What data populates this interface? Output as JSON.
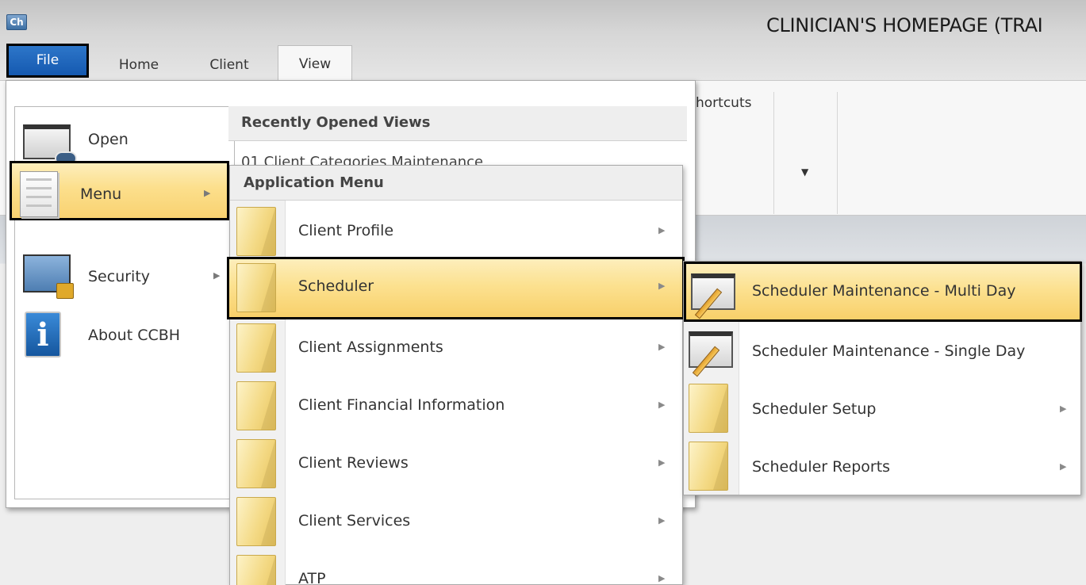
{
  "window": {
    "app_icon": "Ch",
    "title": "CLINICIAN'S HOMEPAGE (TRAI"
  },
  "tabs": {
    "file": "File",
    "home": "Home",
    "client": "Client",
    "view": "View"
  },
  "ribbon": {
    "group_label": "hortcuts",
    "dropdown_glyph": "▼"
  },
  "file_menu": {
    "items": [
      {
        "label": "Open",
        "icon": "binoculars-window-icon"
      },
      {
        "label": "Menu",
        "icon": "document-icon",
        "has_submenu": true,
        "selected": true
      },
      {
        "label": "Security",
        "icon": "security-lock-icon",
        "has_submenu": true
      },
      {
        "label": "About CCBH",
        "icon": "info-icon",
        "glyph": "i"
      }
    ],
    "recent_header": "Recently Opened Views",
    "recent_item": "01 Client Categories Maintenance"
  },
  "application_menu": {
    "header": "Application Menu",
    "items": [
      {
        "label": "Client Profile",
        "icon": "folder-icon"
      },
      {
        "label": "Scheduler",
        "icon": "folder-icon",
        "selected": true
      },
      {
        "label": "Client Assignments",
        "icon": "folder-icon"
      },
      {
        "label": "Client Financial Information",
        "icon": "folder-icon"
      },
      {
        "label": "Client Reviews",
        "icon": "folder-icon"
      },
      {
        "label": "Client Services",
        "icon": "folder-icon"
      },
      {
        "label": "ATP",
        "icon": "folder-icon"
      }
    ]
  },
  "scheduler_submenu": {
    "items": [
      {
        "label": "Scheduler Maintenance - Multi Day",
        "icon": "edit-window-icon",
        "selected": true
      },
      {
        "label": "Scheduler Maintenance - Single Day",
        "icon": "edit-window-icon"
      },
      {
        "label": "Scheduler Setup",
        "icon": "folder-icon",
        "has_submenu": true
      },
      {
        "label": "Scheduler Reports",
        "icon": "folder-icon",
        "has_submenu": true
      }
    ]
  },
  "glyphs": {
    "submenu_arrow": "▶"
  },
  "colors": {
    "file_tab": "#1559b0",
    "highlight": "#f9d271",
    "selection_border": "#000000"
  }
}
